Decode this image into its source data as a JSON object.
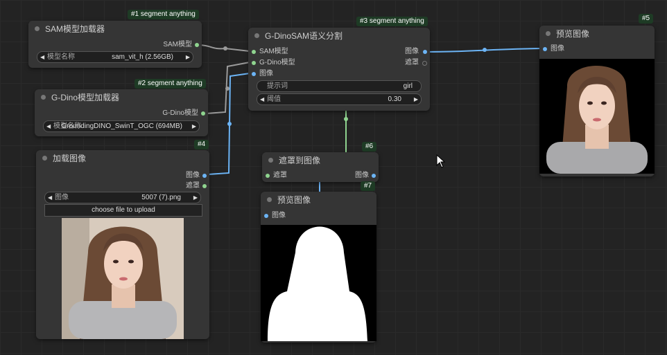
{
  "nodes": {
    "sam_loader": {
      "badge": "#1 segment anything",
      "title": "SAM模型加载器",
      "output": "SAM模型",
      "widget_label": "模型名称",
      "widget_value": "sam_vit_h (2.56GB)"
    },
    "gdino_loader": {
      "badge": "#2 segment anything",
      "title": "G-Dino模型加载器",
      "output": "G-Dino模型",
      "widget_label": "模型名称",
      "widget_value": "GroundingDINO_SwinT_OGC (694MB)"
    },
    "gdino_sam": {
      "badge": "#3 segment anything",
      "title": "G-DinoSAM语义分割",
      "input_sam": "SAM模型",
      "input_gdino": "G-Dino模型",
      "input_image": "图像",
      "output_image": "图像",
      "output_mask": "遮罩",
      "prompt_label": "提示词",
      "prompt_value": "girl",
      "threshold_label": "阈值",
      "threshold_value": "0.30"
    },
    "load_image": {
      "badge": "#4",
      "title": "加载图像",
      "output_image": "图像",
      "output_mask": "遮罩",
      "widget_label": "图像",
      "widget_value": "5007 (7).png",
      "upload_label": "choose file to upload"
    },
    "preview_a": {
      "badge": "#5",
      "title": "预览图像",
      "input": "图像"
    },
    "mask_to_image": {
      "badge": "#6",
      "title": "遮罩到图像",
      "input": "遮罩",
      "output": "图像"
    },
    "preview_b": {
      "badge": "#7",
      "title": "预览图像",
      "input": "图像"
    }
  },
  "colors": {
    "image_link": "#6cb4f5",
    "model_link": "#8fd48f",
    "badge_bg": "#1e3b25"
  }
}
